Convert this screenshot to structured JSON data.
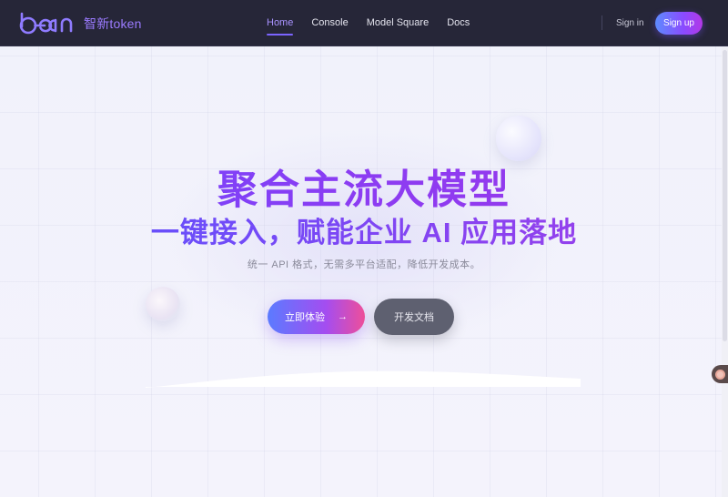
{
  "header": {
    "brand_logo_text": "bean",
    "brand_name": "智新token",
    "nav": [
      {
        "label": "Home",
        "active": true
      },
      {
        "label": "Console",
        "active": false
      },
      {
        "label": "Model Square",
        "active": false
      },
      {
        "label": "Docs",
        "active": false
      }
    ],
    "sign_in": "Sign in",
    "sign_up": "Sign up"
  },
  "hero": {
    "title": "聚合主流大模型",
    "subtitle_line": "一键接入，赋能企业 AI 应用落地",
    "description": "统一 API 格式，无需多平台适配，降低开发成本。",
    "primary_button": "立即体验",
    "primary_button_icon": "arrow-right-icon",
    "secondary_button": "开发文档"
  },
  "colors": {
    "topbar_bg": "#262638",
    "accent": "#7b64ff",
    "brand_text": "#9b7bff",
    "secondary_button_bg": "#5e6070"
  }
}
